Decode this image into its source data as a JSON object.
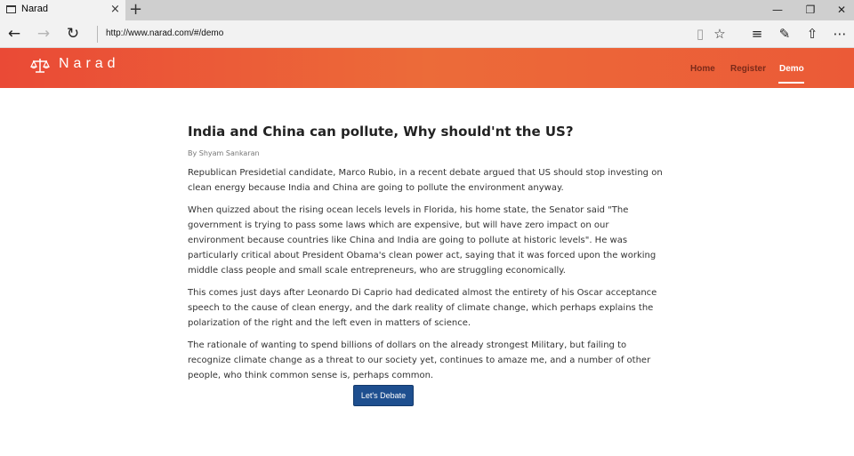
{
  "browser": {
    "tab_title": "Narad",
    "tab_close": "×",
    "new_tab": "+",
    "window_controls": {
      "minimize": "—",
      "restore": "❐",
      "close": "✕"
    },
    "url": "http://www.narad.com/#/demo",
    "icons": [
      "back-icon",
      "forward-icon",
      "refresh-icon",
      "reading-view-icon",
      "favorite-star-icon",
      "hub-icon",
      "web-note-icon",
      "share-icon",
      "more-icon"
    ]
  },
  "site": {
    "brand": "Narad",
    "nav": [
      {
        "label": "Home",
        "active": false
      },
      {
        "label": "Register",
        "active": false
      },
      {
        "label": "Demo",
        "active": true
      }
    ],
    "colors": {
      "header_start": "#ea4a36",
      "header_end": "#ec6b39",
      "button": "#1e4f8f"
    }
  },
  "article": {
    "title": "India and China can pollute, Why should'nt the US?",
    "byline": "By Shyam Sankaran",
    "paragraphs": [
      "Republican Presidetial candidate, Marco Rubio, in a recent debate argued that US should stop investing on clean energy because India and China are going to pollute the environment anyway.",
      "When quizzed about the rising ocean lecels levels in Florida, his home state, the Senator said \"The government is trying to pass some laws which are expensive, but will have zero impact on our environment because countries like China and India are going to pollute at historic levels\". He was particularly critical about President Obama's clean power act, saying that it was forced upon the working middle class people and small scale entrepreneurs, who are struggling economically.",
      "This comes just days after Leonardo Di Caprio had dedicated almost the entirety of his Oscar acceptance speech to the cause of clean energy, and the dark reality of climate change, which perhaps explains the polarization of the right and the left even in matters of science.",
      "The rationale of wanting to spend billions of dollars on the already strongest Military, but failing to recognize climate change as a threat to our society yet, continues to amaze me, and a number of other people, who think common sense is, perhaps common."
    ],
    "button_label": "Let's Debate"
  }
}
